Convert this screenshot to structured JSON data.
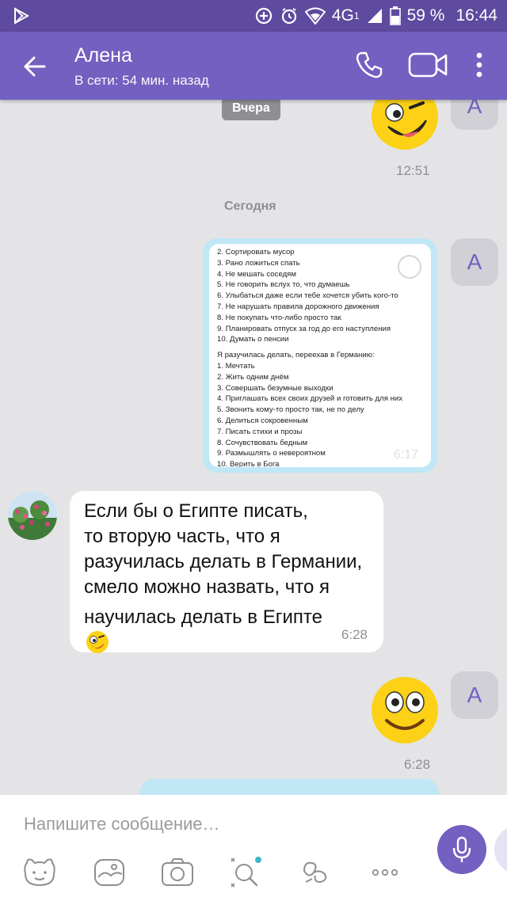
{
  "status_bar": {
    "battery_text": "59 %",
    "time": "16:44",
    "network_label": "4G",
    "network_sub": "1"
  },
  "header": {
    "contact_name": "Алена",
    "presence": "В сети: 54 мин. назад"
  },
  "chat": {
    "chip_yesterday": "Вчера",
    "chip_today": "Сегодня",
    "avatar_letter": "А",
    "sticker1_time": "12:51",
    "image_message": {
      "time": "6:17",
      "lines_top": [
        "2. Сортировать мусор",
        "3. Рано ложиться спать",
        "4. Не мешать соседям",
        "5. Не говорить вслух то, что думаешь",
        "6. Улыбаться даже если тебе хочется убить кого-то",
        "7. Не нарушать правила дорожного движения",
        "8. Не покупать что-либо просто так",
        "9. Планировать отпуск за год до его наступления",
        "10. Думать о пенсии"
      ],
      "lines_bottom": [
        "Я разучилась делать, переехав в Германию:",
        "1. Мечтать",
        "2. Жить одним днём",
        "3. Совершать безумные выходки",
        "4. Приглашать всех своих друзей и готовить для них",
        "5. Звонить кому-то просто так, не по делу",
        "6. Делиться сокровенным",
        "7. Писать стихи и прозы",
        "8. Сочувствовать бедным",
        "9. Размышлять о невероятном",
        "10. Верить в Бога"
      ]
    },
    "incoming_message": {
      "lines": [
        "Если бы о Египте писать,",
        "то вторую часть,  что я",
        "разучилась делать в Германии,",
        "смело можно назвать,  что я",
        "научилась делать в Египте"
      ],
      "time": "6:28"
    },
    "sticker2_time": "6:28"
  },
  "composer": {
    "placeholder": "Напишите сообщение…"
  },
  "colors": {
    "header": "#7360c0",
    "status_bar": "#5e4a9e",
    "outgoing_bubble": "#bfe7f5",
    "chat_bg": "#e4e4e6",
    "accent": "#7360c0"
  },
  "icons": {
    "back": "arrow-left-icon",
    "call": "phone-icon",
    "video": "video-camera-icon",
    "more": "more-vertical-icon",
    "mic": "microphone-icon",
    "tools": [
      "sticker-icon",
      "gallery-icon",
      "camera-icon",
      "gif-search-icon",
      "doodle-icon",
      "more-horizontal-icon"
    ]
  }
}
